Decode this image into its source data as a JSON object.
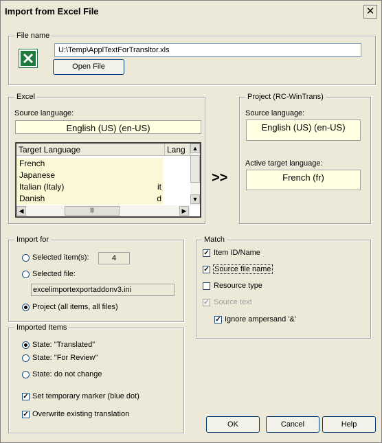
{
  "window": {
    "title": "Import from Excel File",
    "close_glyph": "✕"
  },
  "file_group": {
    "label": "File name",
    "path": "U:\\Temp\\ApplTextForTransltor.xls",
    "open_button": "Open File"
  },
  "excel_group": {
    "label": "Excel",
    "source_label": "Source language:",
    "source_value": "English (US) (en-US)",
    "list": {
      "headers": [
        "Target Language",
        "Lang"
      ],
      "rows": [
        {
          "name": "French",
          "code": ""
        },
        {
          "name": "Japanese",
          "code": ""
        },
        {
          "name": "Italian (Italy)",
          "code": "it"
        },
        {
          "name": "Danish",
          "code": "d"
        }
      ]
    }
  },
  "arrows": ">>",
  "project_group": {
    "label": "Project (RC-WinTrans)",
    "source_label": "Source language:",
    "source_value": "English (US) (en-US)",
    "target_label": "Active target language:",
    "target_value": "French (fr)"
  },
  "import_for": {
    "label": "Import for",
    "selected_items_label": "Selected item(s):",
    "selected_items_count": "4",
    "selected_file_label": "Selected file:",
    "selected_file_value": "excelimportexportaddonv3.ini",
    "project_label": "Project (all items, all files)",
    "selected": "project"
  },
  "imported_items": {
    "label": "Imported Items",
    "state_translated": "State: \"Translated\"",
    "state_review": "State: \"For Review\"",
    "state_nochange": "State:  do not change",
    "selected": "translated",
    "temp_marker_label": "Set temporary marker (blue dot)",
    "temp_marker_checked": true,
    "overwrite_label": "Overwrite existing translation",
    "overwrite_checked": true
  },
  "match": {
    "label": "Match",
    "item_id": {
      "label": "Item ID/Name",
      "checked": true
    },
    "source_file": {
      "label": "Source file name",
      "checked": true
    },
    "resource_type": {
      "label": "Resource type",
      "checked": false
    },
    "source_text": {
      "label": "Source text",
      "checked": true,
      "disabled": true
    },
    "ignore_amp": {
      "label": "Ignore ampersand '&'",
      "checked": true
    }
  },
  "buttons": {
    "ok": "OK",
    "cancel": "Cancel",
    "help": "Help"
  },
  "check_glyph": "✓",
  "scroll_glyphs": {
    "up": "▲",
    "down": "▼",
    "left": "◀",
    "right": "▶",
    "grip": "|||"
  },
  "colors": {
    "dialog_bg": "#ece9d8",
    "readonly_bg": "#ffffe1",
    "list_row_bg": "#fbf8d6",
    "excel_green": "#1f7a3e"
  }
}
